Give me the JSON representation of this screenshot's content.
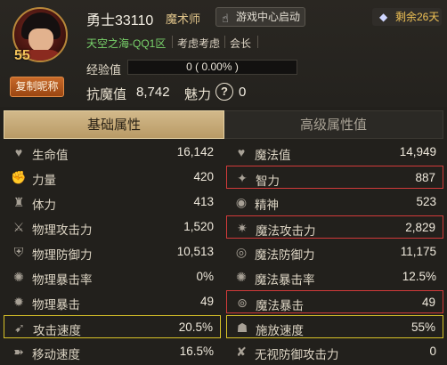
{
  "player": {
    "name": "勇士33110",
    "class": "魔术师",
    "level": "55",
    "server": "天空之海-QQ1区",
    "guild": "考虑考虑",
    "role": "会长",
    "copy_name_label": "复制昵称",
    "launch_label": "游戏中心启动",
    "remaining_label": "剩余26天"
  },
  "exp": {
    "label": "经验值",
    "text": "0 ( 0.00% )",
    "progress": 0.0
  },
  "resist": {
    "label": "抗魔值",
    "value": "8,742"
  },
  "charm": {
    "label": "魅力",
    "icon_glyph": "?",
    "value": "0"
  },
  "tabs": {
    "basic": "基础属性",
    "advanced": "高级属性值",
    "active": "basic"
  },
  "stats_left": [
    {
      "icon": "heart-icon",
      "glyph": "♥",
      "label": "生命值",
      "value": "16,142",
      "highlight": ""
    },
    {
      "icon": "fist-icon",
      "glyph": "✊",
      "label": "力量",
      "value": "420",
      "highlight": ""
    },
    {
      "icon": "body-icon",
      "glyph": "♜",
      "label": "体力",
      "value": "413",
      "highlight": ""
    },
    {
      "icon": "sword-icon",
      "glyph": "⚔",
      "label": "物理攻击力",
      "value": "1,520",
      "highlight": ""
    },
    {
      "icon": "shield-icon",
      "glyph": "⛨",
      "label": "物理防御力",
      "value": "10,513",
      "highlight": ""
    },
    {
      "icon": "crit-rate-icon",
      "glyph": "✺",
      "label": "物理暴击率",
      "value": "0%",
      "highlight": ""
    },
    {
      "icon": "crit-icon",
      "glyph": "✹",
      "label": "物理暴击",
      "value": "49",
      "highlight": ""
    },
    {
      "icon": "attack-speed-icon",
      "glyph": "➹",
      "label": "攻击速度",
      "value": "20.5%",
      "highlight": "yellow"
    },
    {
      "icon": "move-speed-icon",
      "glyph": "➽",
      "label": "移动速度",
      "value": "16.5%",
      "highlight": ""
    }
  ],
  "stats_right": [
    {
      "icon": "mana-icon",
      "glyph": "♥",
      "label": "魔法值",
      "value": "14,949",
      "highlight": ""
    },
    {
      "icon": "intelligence-icon",
      "glyph": "✦",
      "label": "智力",
      "value": "887",
      "highlight": "red"
    },
    {
      "icon": "spirit-icon",
      "glyph": "◉",
      "label": "精神",
      "value": "523",
      "highlight": ""
    },
    {
      "icon": "magic-attack-icon",
      "glyph": "✷",
      "label": "魔法攻击力",
      "value": "2,829",
      "highlight": "red"
    },
    {
      "icon": "magic-defense-icon",
      "glyph": "◎",
      "label": "魔法防御力",
      "value": "11,175",
      "highlight": ""
    },
    {
      "icon": "magic-crit-rate-icon",
      "glyph": "✺",
      "label": "魔法暴击率",
      "value": "12.5%",
      "highlight": ""
    },
    {
      "icon": "magic-crit-icon",
      "glyph": "⊚",
      "label": "魔法暴击",
      "value": "49",
      "highlight": "red"
    },
    {
      "icon": "cast-speed-icon",
      "glyph": "☗",
      "label": "施放速度",
      "value": "55%",
      "highlight": "yellow"
    },
    {
      "icon": "ignore-defense-icon",
      "glyph": "✘",
      "label": "无视防御攻击力",
      "value": "0",
      "highlight": ""
    }
  ],
  "colors": {
    "accent": "#f0c255",
    "server_green": "#79d36b",
    "highlight_red": "#d23a3a",
    "highlight_yellow": "#d8c228"
  }
}
